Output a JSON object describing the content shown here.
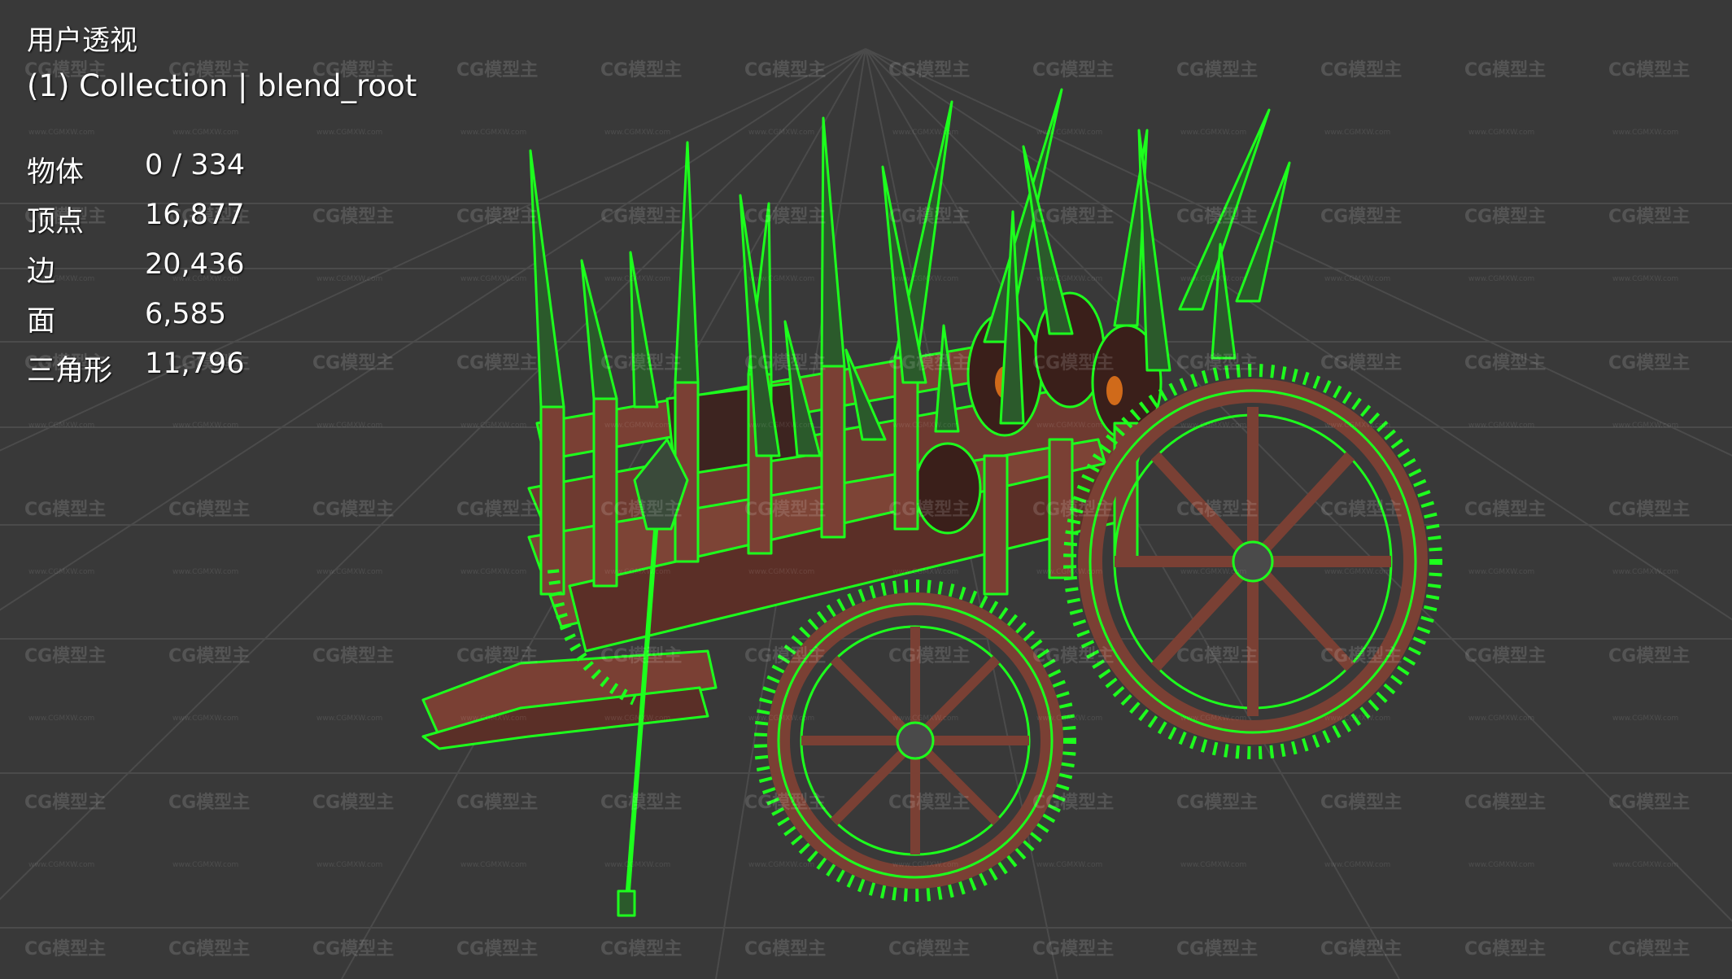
{
  "viewport": {
    "view_name": "用户透视",
    "collection_label": "(1) Collection | blend_root",
    "stats": [
      {
        "label": "物体",
        "value": "0 / 334"
      },
      {
        "label": "顶点",
        "value": "16,877"
      },
      {
        "label": "边",
        "value": "20,436"
      },
      {
        "label": "面",
        "value": "6,585"
      },
      {
        "label": "三角形",
        "value": "11,796"
      }
    ]
  },
  "watermark": {
    "text": "CG模型主",
    "subtext": "www.CGMXW.com"
  },
  "colors": {
    "background": "#393939",
    "grid": "#4a4a4a",
    "wire": "#1dff1d",
    "wood": "#7a4034",
    "wood_dark": "#3d2420"
  },
  "model": {
    "name": "spiked war cart",
    "icon": "cart-3d-model"
  }
}
